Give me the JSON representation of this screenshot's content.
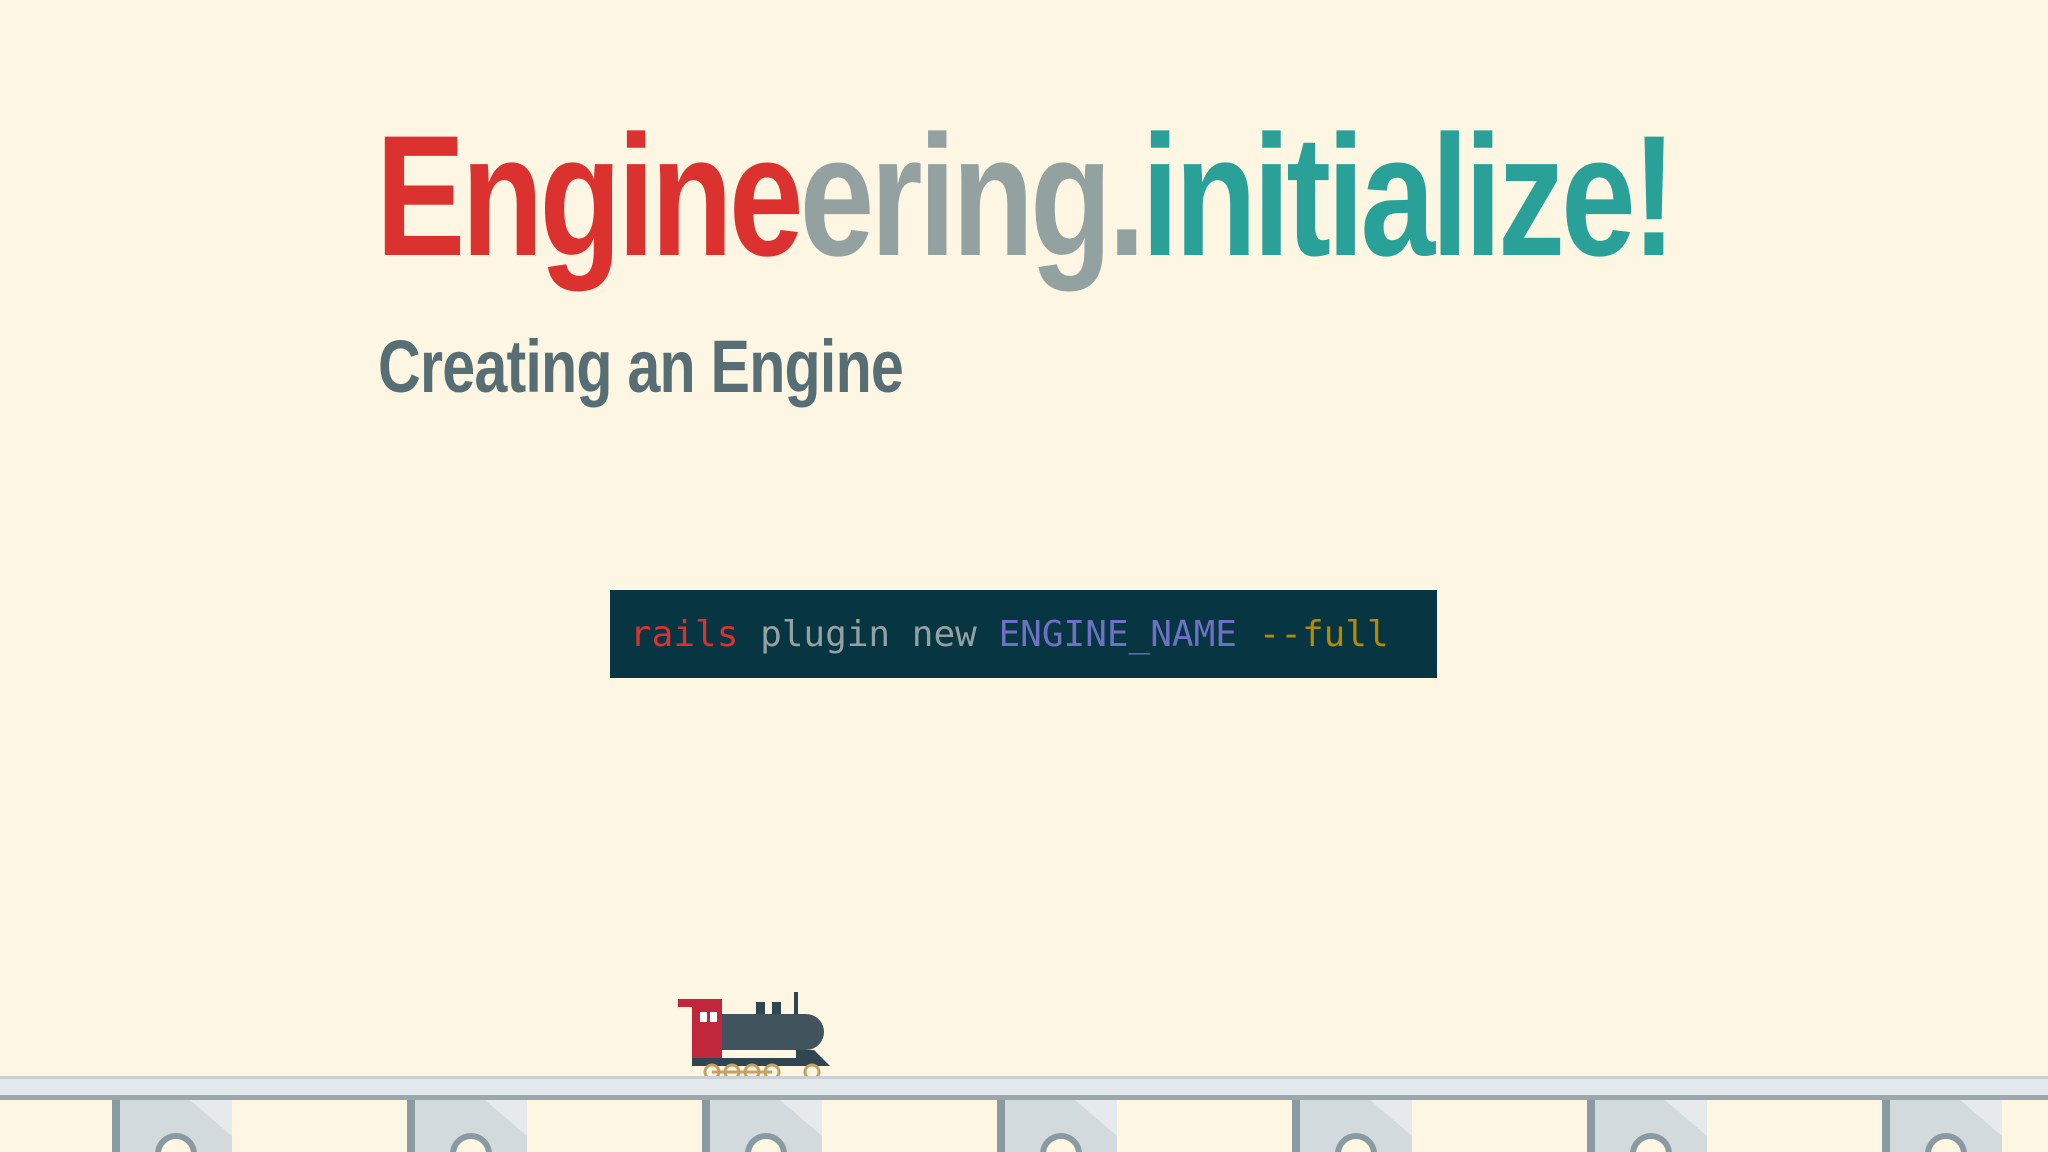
{
  "slide": {
    "title_parts": [
      "Engine",
      "ering.",
      "initialize!"
    ],
    "subtitle": "Creating an Engine"
  },
  "code": {
    "command": "rails",
    "subcommand": "plugin new",
    "argument": "ENGINE_NAME",
    "flag": "--full"
  },
  "colors": {
    "background": "#fdf6e3",
    "red": "#dc322f",
    "gray": "#93a1a1",
    "teal": "#2aa198",
    "subtitle": "#586e75",
    "code_background": "#073642",
    "code_argument": "#6c71c4",
    "code_flag": "#b58900"
  },
  "icons": [
    "train-icon",
    "railway-track"
  ]
}
